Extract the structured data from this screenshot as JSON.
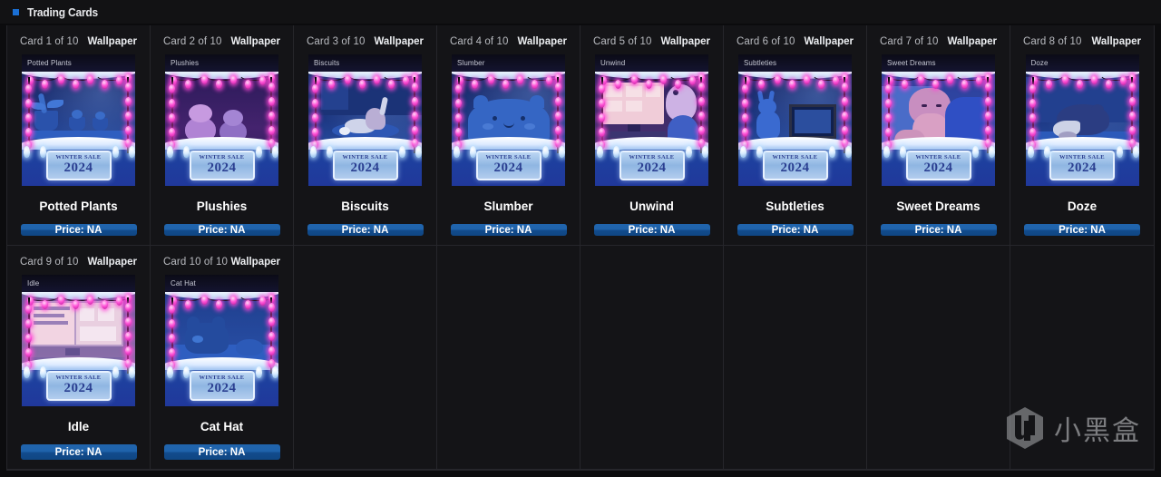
{
  "header": {
    "title": "Trading Cards",
    "bullet_color": "#1a6fd4"
  },
  "labels": {
    "kind": "Wallpaper",
    "price": "Price: NA",
    "plaque_line1": "WINTER SALE",
    "plaque_line2": "2024"
  },
  "theme": {
    "page_background": "#0c0c0e",
    "cell_background": "#141417",
    "grid_border": "#26262b",
    "button_blue": "#1f63ab",
    "light_pink": "#ff55d8"
  },
  "watermark": {
    "text": "小黑盒",
    "logo": "xiaoheihe-logo"
  },
  "cards": [
    {
      "index": "Card 1 of 10",
      "kind": "Wallpaper",
      "name": "Potted Plants",
      "thumb_title": "Potted Plants",
      "price": "Price: NA"
    },
    {
      "index": "Card 2 of 10",
      "kind": "Wallpaper",
      "name": "Plushies",
      "thumb_title": "Plushies",
      "price": "Price: NA"
    },
    {
      "index": "Card 3 of 10",
      "kind": "Wallpaper",
      "name": "Biscuits",
      "thumb_title": "Biscuits",
      "price": "Price: NA"
    },
    {
      "index": "Card 4 of 10",
      "kind": "Wallpaper",
      "name": "Slumber",
      "thumb_title": "Slumber",
      "price": "Price: NA"
    },
    {
      "index": "Card 5 of 10",
      "kind": "Wallpaper",
      "name": "Unwind",
      "thumb_title": "Unwind",
      "price": "Price: NA"
    },
    {
      "index": "Card 6 of 10",
      "kind": "Wallpaper",
      "name": "Subtleties",
      "thumb_title": "Subtleties",
      "price": "Price: NA"
    },
    {
      "index": "Card 7 of 10",
      "kind": "Wallpaper",
      "name": "Sweet Dreams",
      "thumb_title": "Sweet Dreams",
      "price": "Price: NA"
    },
    {
      "index": "Card 8 of 10",
      "kind": "Wallpaper",
      "name": "Doze",
      "thumb_title": "Doze",
      "price": "Price: NA"
    },
    {
      "index": "Card 9 of 10",
      "kind": "Wallpaper",
      "name": "Idle",
      "thumb_title": "Idle",
      "price": "Price: NA"
    },
    {
      "index": "Card 10 of 10",
      "kind": "Wallpaper",
      "name": "Cat Hat",
      "thumb_title": "Cat Hat",
      "price": "Price: NA"
    }
  ],
  "grid": {
    "columns": 8,
    "rows": 2,
    "empty_cells": 6
  }
}
